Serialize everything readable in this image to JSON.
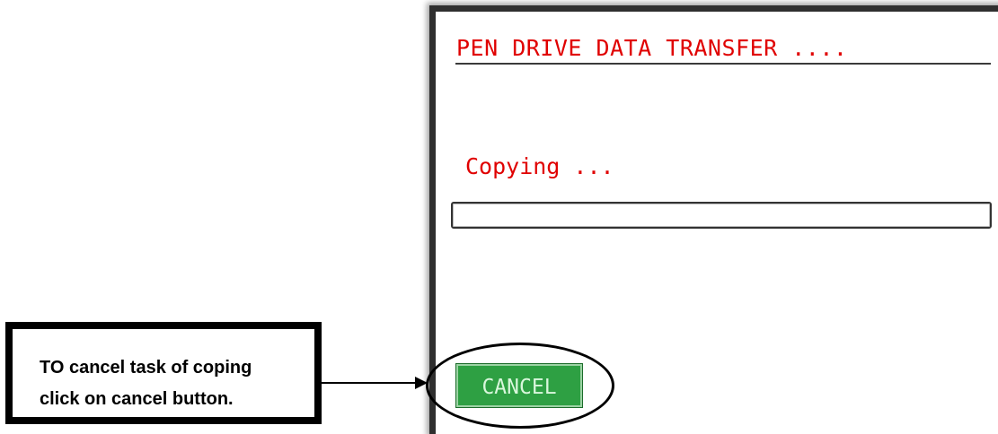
{
  "dialog": {
    "title": "PEN DRIVE DATA TRANSFER ....",
    "status": "Copying ...",
    "progress_percent": 0,
    "cancel_label": "CANCEL",
    "title_color": "#e00000",
    "cancel_color": "#2ea043"
  },
  "annotation": {
    "text": "TO cancel task of coping\nclick on cancel button."
  }
}
